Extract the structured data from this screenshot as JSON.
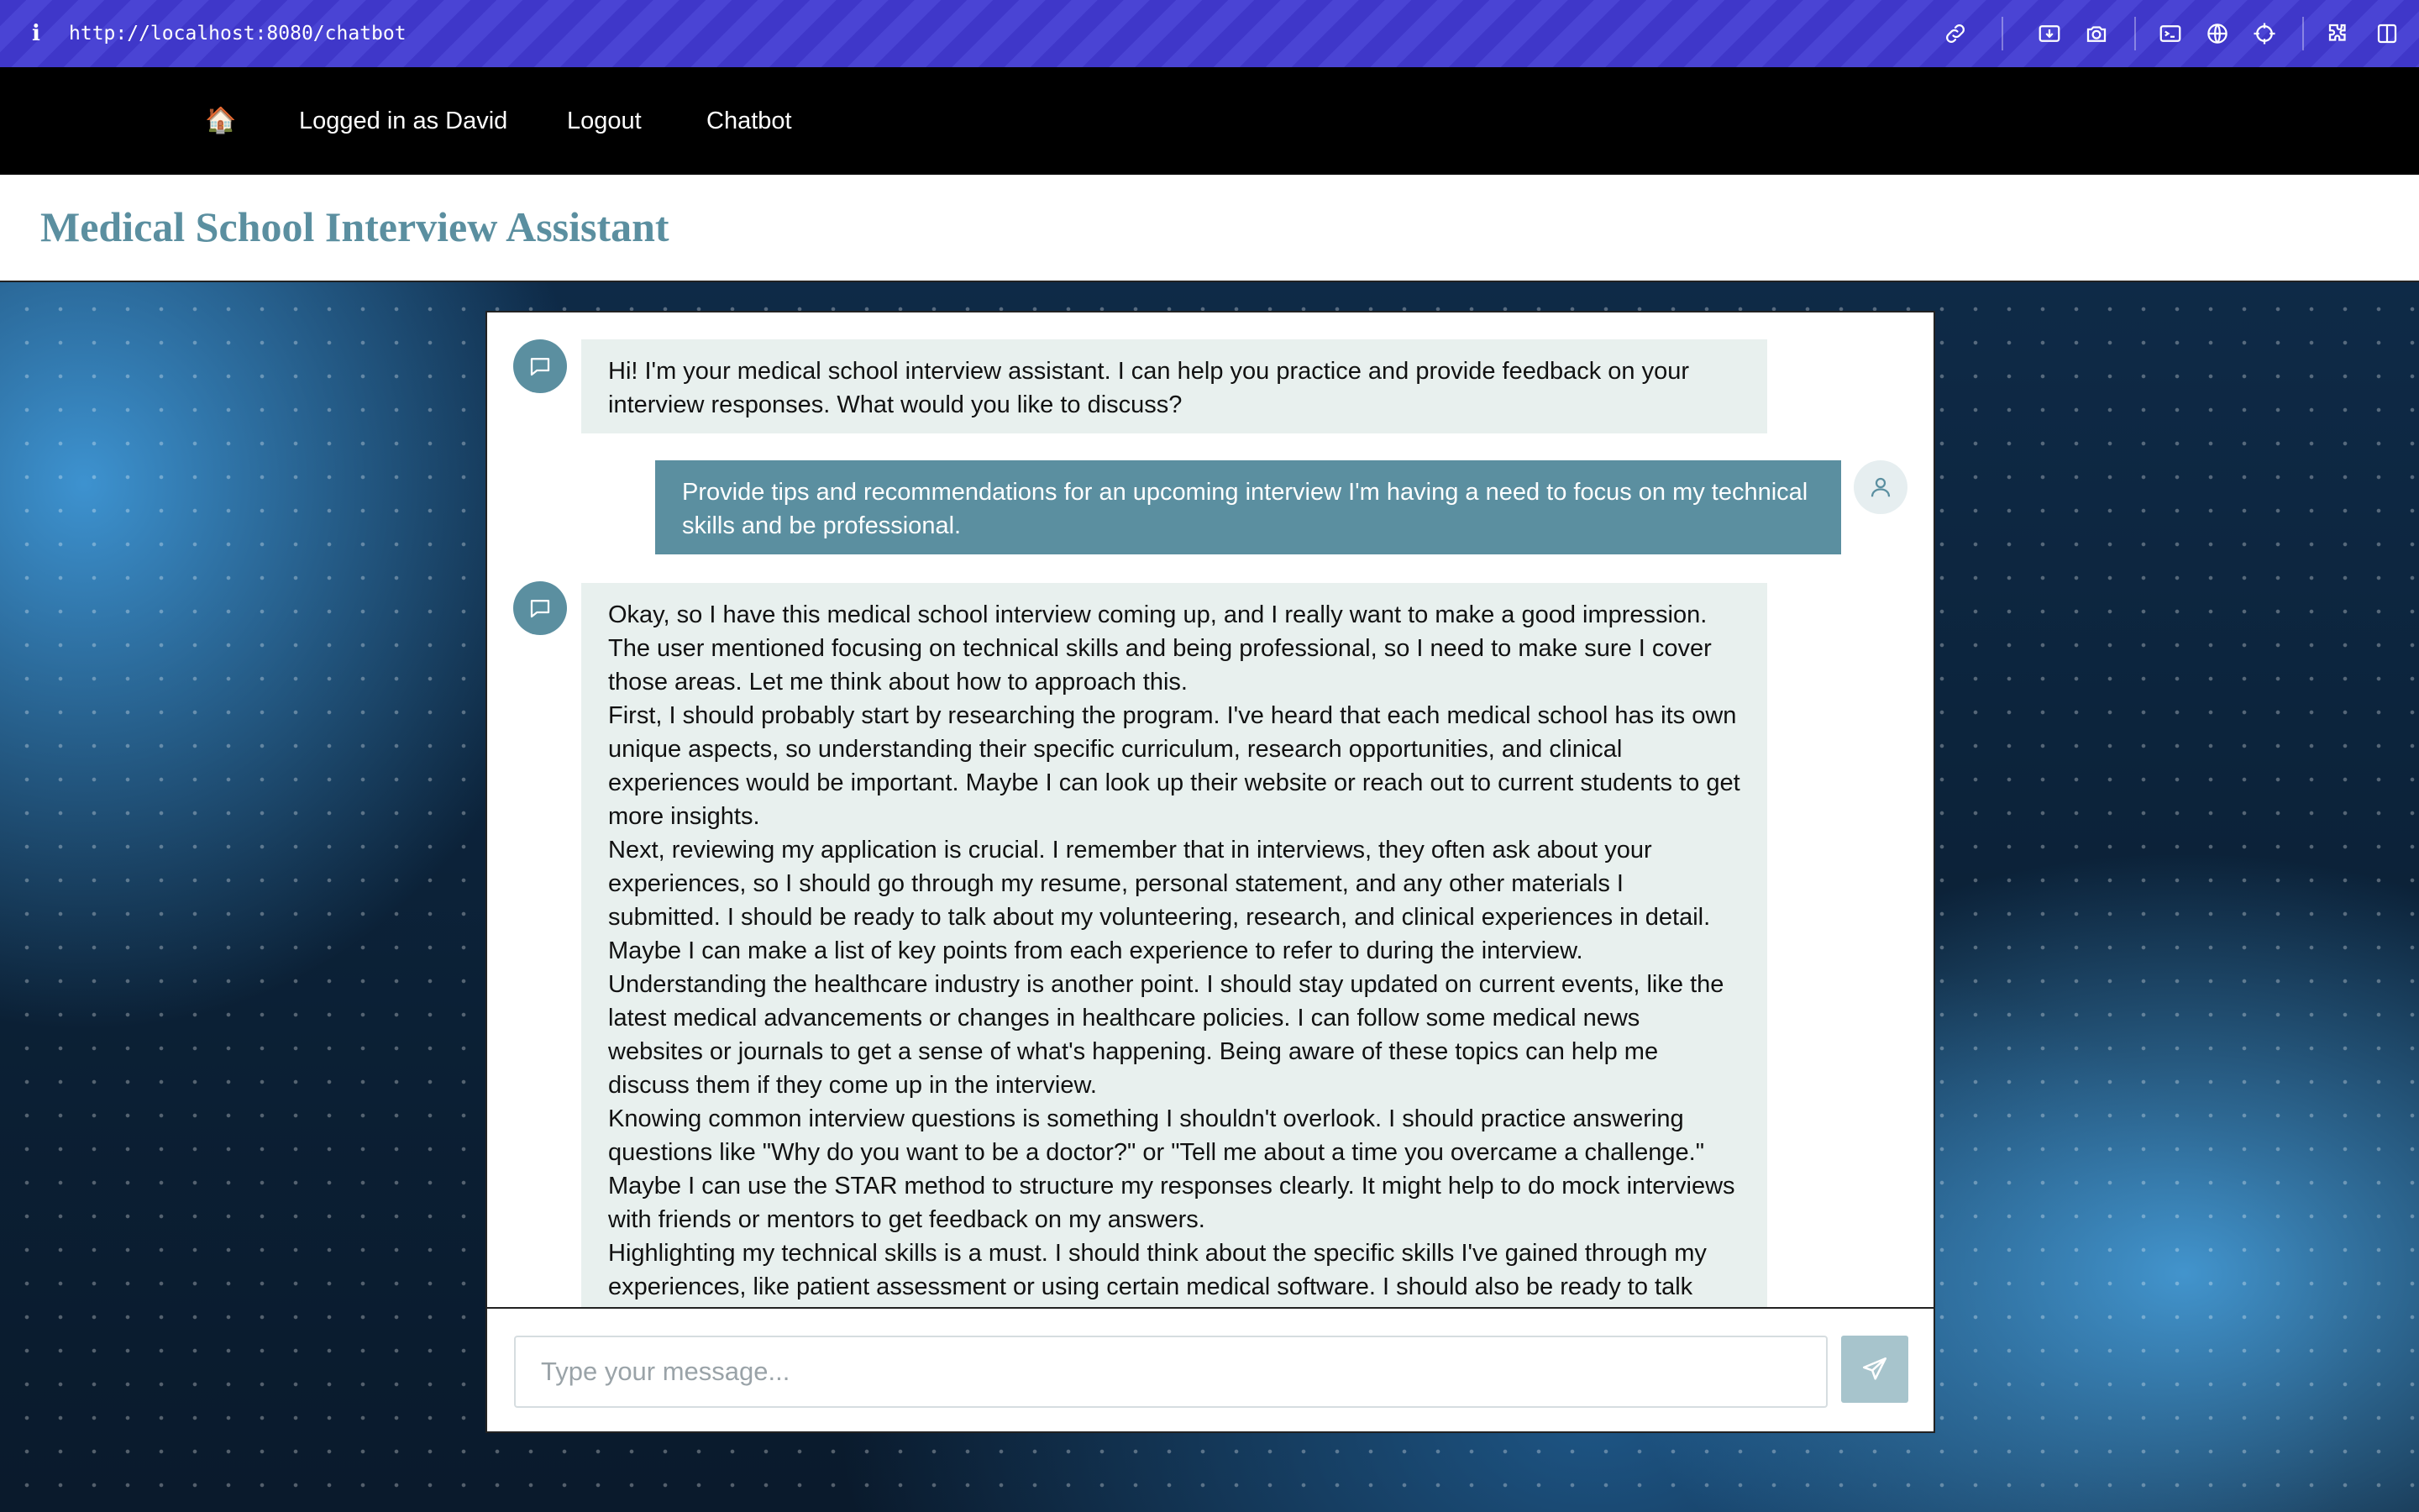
{
  "browser": {
    "url": "http://localhost:8080/chatbot",
    "info_icon": "info-icon",
    "toolbar_icons": [
      "link-icon",
      "screenshot-area-icon",
      "camera-icon",
      "terminal-icon",
      "globe-icon",
      "crosshair-icon",
      "extensions-icon",
      "sidebar-icon"
    ]
  },
  "nav": {
    "home_icon": "🏠",
    "logged_in": "Logged in as David",
    "logout": "Logout",
    "chatbot": "Chatbot"
  },
  "header": {
    "title": "Medical School Interview Assistant"
  },
  "colors": {
    "accent": "#5b8fa0",
    "bot_bubble": "#e8f0ee",
    "send_button": "#a7c4cc",
    "browser_bar": "#3f37c9"
  },
  "chat": {
    "messages": [
      {
        "role": "assistant",
        "paragraphs": [
          "Hi! I'm your medical school interview assistant. I can help you practice and provide feedback on your interview responses. What would you like to discuss?"
        ]
      },
      {
        "role": "user",
        "paragraphs": [
          "Provide tips and recommendations for an upcoming interview I'm having a need to focus on my technical skills and be professional."
        ]
      },
      {
        "role": "assistant",
        "paragraphs": [
          "Okay, so I have this medical school interview coming up, and I really want to make a good impression. The user mentioned focusing on technical skills and being professional, so I need to make sure I cover those areas. Let me think about how to approach this.",
          "First, I should probably start by researching the program. I've heard that each medical school has its own unique aspects, so understanding their specific curriculum, research opportunities, and clinical experiences would be important. Maybe I can look up their website or reach out to current students to get more insights.",
          "Next, reviewing my application is crucial. I remember that in interviews, they often ask about your experiences, so I should go through my resume, personal statement, and any other materials I submitted. I should be ready to talk about my volunteering, research, and clinical experiences in detail. Maybe I can make a list of key points from each experience to refer to during the interview.",
          "Understanding the healthcare industry is another point. I should stay updated on current events, like the latest medical advancements or changes in healthcare policies. I can follow some medical news websites or journals to get a sense of what's happening. Being aware of these topics can help me discuss them if they come up in the interview.",
          "Knowing common interview questions is something I shouldn't overlook. I should practice answering questions like \"Why do you want to be a doctor?\" or \"Tell me about a time you overcame a challenge.\" Maybe I can use the STAR method to structure my responses clearly. It might help to do mock interviews with friends or mentors to get feedback on my answers.",
          "Highlighting my technical skills is a must. I should think about the specific skills I've gained through my experiences, like patient assessment or using certain medical software. I should also be ready to talk about how I stay updated with medical knowledge, maybe through courses or self-study. If I have any certifications,"
        ]
      }
    ],
    "input_placeholder": "Type your message...",
    "send_icon": "send-icon"
  }
}
